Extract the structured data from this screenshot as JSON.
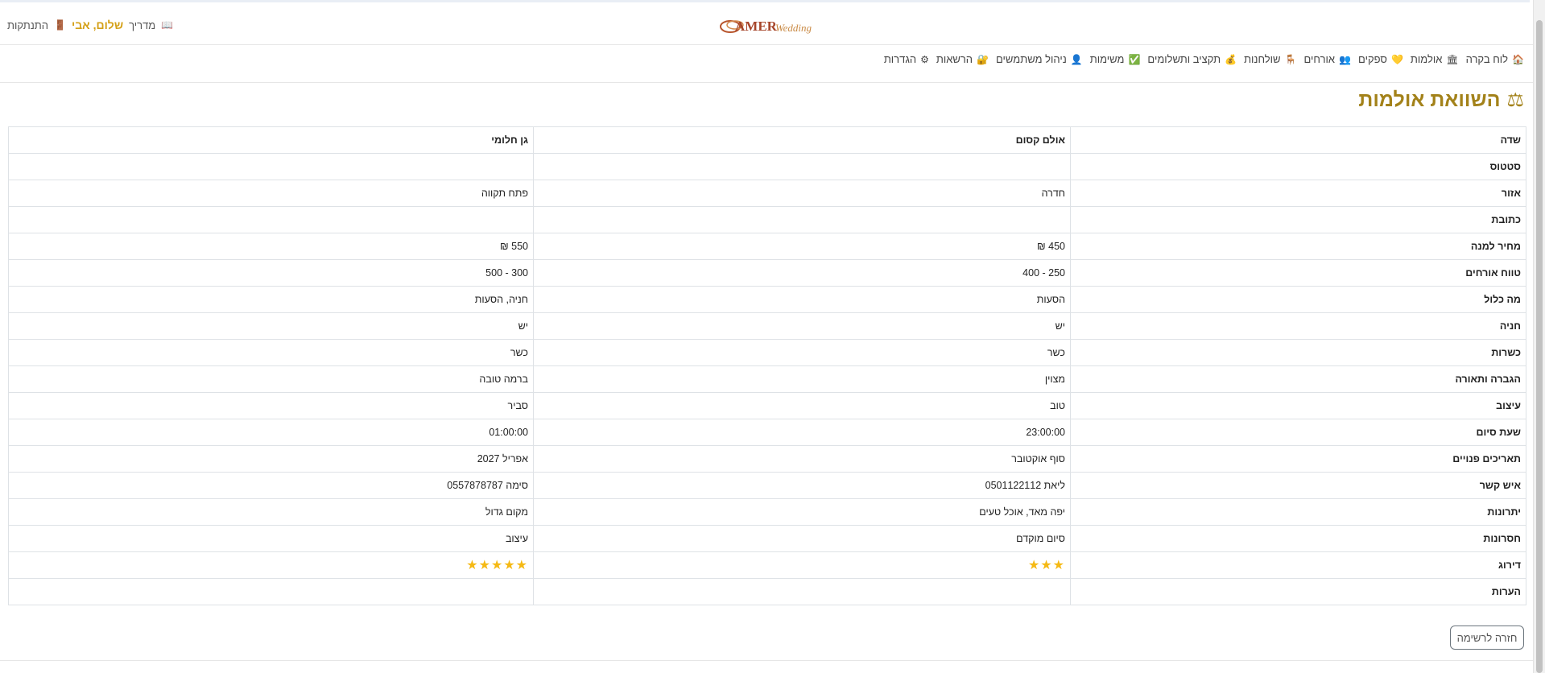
{
  "header": {
    "logo_text": "AMER",
    "logo_script": "Wedding",
    "guide_label": "מדריך",
    "greeting": "שלום, אבי",
    "logout_label": "התנתקות"
  },
  "nav": [
    {
      "label": "לוח בקרה",
      "icon": "🏠",
      "name": "dashboard"
    },
    {
      "label": "אולמות",
      "icon": "🏛",
      "name": "halls"
    },
    {
      "label": "ספקים",
      "icon": "💛",
      "name": "suppliers"
    },
    {
      "label": "אורחים",
      "icon": "👥",
      "name": "guests"
    },
    {
      "label": "שולחנות",
      "icon": "🪑",
      "name": "tables"
    },
    {
      "label": "תקציב ותשלומים",
      "icon": "💰",
      "name": "budget"
    },
    {
      "label": "משימות",
      "icon": "✅",
      "name": "tasks"
    },
    {
      "label": "ניהול משתמשים",
      "icon": "👤",
      "name": "users"
    },
    {
      "label": "הרשאות",
      "icon": "🔐",
      "name": "permissions"
    },
    {
      "label": "הגדרות",
      "icon": "⚙",
      "name": "settings"
    }
  ],
  "page": {
    "title": "השוואת אולמות",
    "title_icon": "⚖",
    "back_label": "חזרה לרשימה"
  },
  "table": {
    "header": [
      "שדה",
      "אולם קסום",
      "גן חלומי"
    ],
    "rows": [
      [
        "סטטוס",
        "",
        ""
      ],
      [
        "אזור",
        "חדרה",
        "פתח תקווה"
      ],
      [
        "כתובת",
        "",
        ""
      ],
      [
        "מחיר למנה",
        "450 ₪",
        "550 ₪"
      ],
      [
        "טווח אורחים",
        "250 - 400",
        "300 - 500"
      ],
      [
        "מה כלול",
        "הסעות",
        "חניה, הסעות"
      ],
      [
        "חניה",
        "יש",
        "יש"
      ],
      [
        "כשרות",
        "כשר",
        "כשר"
      ],
      [
        "הגברה ותאורה",
        "מצוין",
        "ברמה טובה"
      ],
      [
        "עיצוב",
        "טוב",
        "סביר"
      ],
      [
        "שעת סיום",
        "23:00:00",
        "01:00:00"
      ],
      [
        "תאריכים פנויים",
        "סוף אוקטובר",
        "אפריל 2027"
      ],
      [
        "איש קשר",
        "ליאת 0501122112",
        "סימה 0557878787"
      ],
      [
        "יתרונות",
        "יפה מאד, אוכל טעים",
        "מקום גדול"
      ],
      [
        "חסרונות",
        "סיום מוקדם",
        "עיצוב"
      ],
      [
        "דירוג",
        "★★★",
        "★★★★★"
      ],
      [
        "הערות",
        "",
        ""
      ]
    ]
  },
  "ratings": {
    "hall_1": 3,
    "hall_2": 5,
    "max": 5
  },
  "colors": {
    "title": "#a3821a",
    "greeting": "#d4a017",
    "stars": "#f5b914"
  }
}
